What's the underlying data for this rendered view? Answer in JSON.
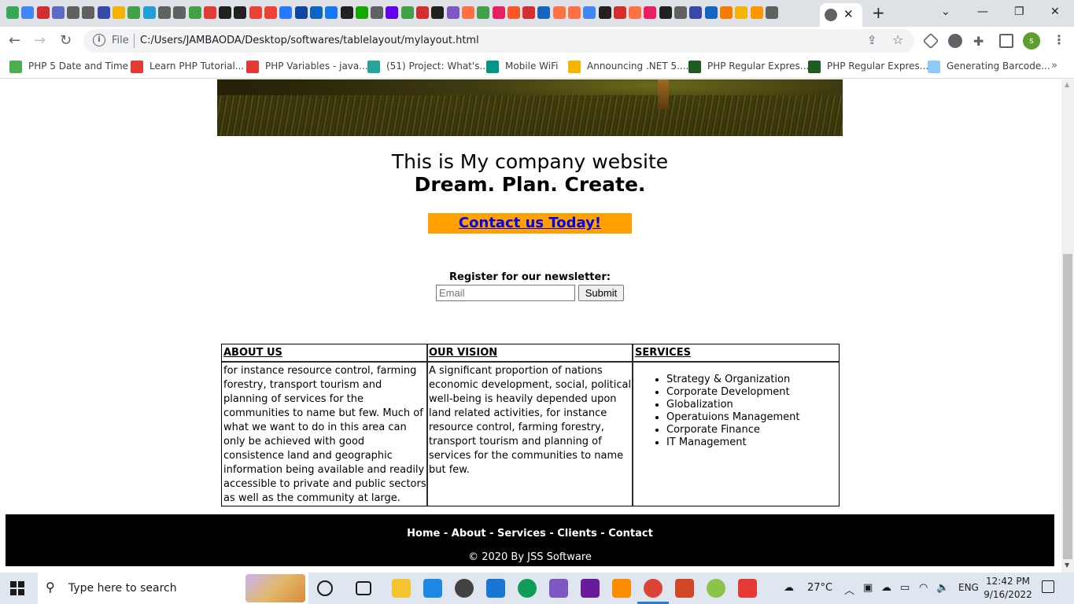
{
  "browser": {
    "address_scheme": "File",
    "address_url": "C:/Users/JAMBAODA/Desktop/softwares/tablelayout/mylayout.html",
    "profile_initial": "s",
    "bookmarks": [
      {
        "label": "PHP 5 Date and Time",
        "color": "#4caf50"
      },
      {
        "label": "Learn PHP Tutorial...",
        "color": "#e53935"
      },
      {
        "label": "PHP Variables - java...",
        "color": "#e53935"
      },
      {
        "label": "(51) Project: What's...",
        "color": "#26a69a"
      },
      {
        "label": "Mobile WiFi",
        "color": "#009688"
      },
      {
        "label": "Announcing .NET 5....",
        "color": "#f4b400"
      },
      {
        "label": "PHP Regular Expres...",
        "color": "#1b5e20"
      },
      {
        "label": "PHP Regular Expres...",
        "color": "#1b5e20"
      },
      {
        "label": "Generating Barcode...",
        "color": "#90caf9"
      }
    ],
    "tab_colors": [
      "#34a853",
      "#4285f4",
      "#d32f2f",
      "#5c6bc0",
      "#616161",
      "#616161",
      "#3949ab",
      "#f4b400",
      "#43a047",
      "#229ed9",
      "#616161",
      "#616161",
      "#43a047",
      "#e53935",
      "#212121",
      "#212121",
      "#ea4335",
      "#ea4335",
      "#2979ff",
      "#0d47a1",
      "#0a66c2",
      "#1877f2",
      "#212121",
      "#14a800",
      "#616161",
      "#6200ea",
      "#43a047",
      "#d32f2f",
      "#212121",
      "#7e57c2",
      "#ff7043",
      "#43a047",
      "#e91e63",
      "#ff5722",
      "#d32f2f",
      "#1565c0",
      "#ff7043",
      "#ff7043",
      "#4285f4",
      "#212121",
      "#d32f2f",
      "#ff7043",
      "#e91e63",
      "#212121",
      "#616161",
      "#3949ab",
      "#1565c0",
      "#f57c00",
      "#f4b400",
      "#ff9800",
      "#616161"
    ]
  },
  "page": {
    "tagline": "This is My company website",
    "slogan": "Dream. Plan. Create.",
    "cta_label": "Contact us Today!",
    "newsletter": {
      "label": "Register for our newsletter:",
      "email_placeholder": "Email",
      "submit_label": "Submit"
    },
    "table": {
      "headers": [
        "ABOUT US",
        "OUR VISION",
        "SERVICES"
      ],
      "about_text": "for instance resource control, farming forestry, transport tourism and planning of services for the communities to name but few. Much of what we want to do in this area can only be achieved with good consistence land and geographic information being available and readily accessible to private and public sectors as well as the community at large.",
      "vision_text": "A significant proportion of nations economic development, social, political well-being is heavily depended upon land related activities, for instance resource control, farming forestry, transport tourism and planning of services for the communities to name but few.",
      "services": [
        "Strategy & Organization",
        "Corporate Development",
        "Globalization",
        "Operatuions Management",
        "Corporate Finance",
        "IT Management"
      ]
    },
    "footer": {
      "nav": [
        "Home",
        "About",
        "Services",
        "Clients",
        "Contact"
      ],
      "separator": " - ",
      "copyright": "© 2020 By JSS Software"
    }
  },
  "taskbar": {
    "search_placeholder": "Type here to search",
    "weather": "27°C",
    "language": "ENG",
    "time": "12:42 PM",
    "date": "9/16/2022"
  }
}
